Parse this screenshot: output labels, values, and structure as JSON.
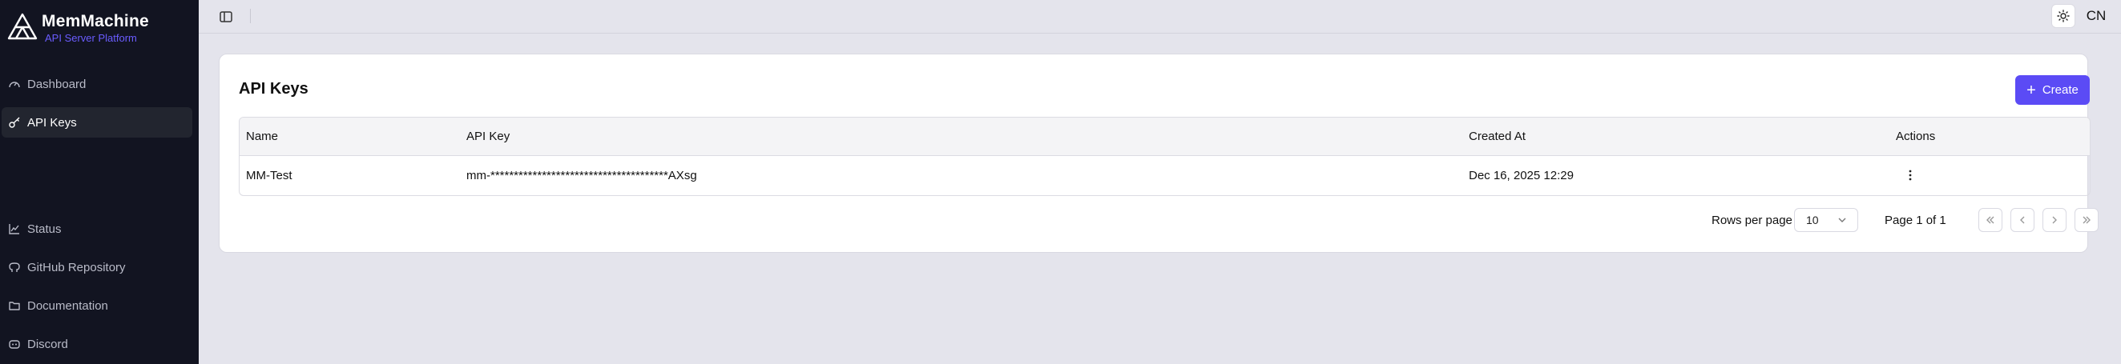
{
  "brand": {
    "title": "MemMachine",
    "subtitle": "API Server Platform"
  },
  "sidebar": {
    "items": [
      {
        "label": "Dashboard",
        "icon": "gauge-icon",
        "active": false
      },
      {
        "label": "API Keys",
        "icon": "key-icon",
        "active": true
      },
      {
        "label": "Status",
        "icon": "chart-line-icon",
        "active": false
      },
      {
        "label": "GitHub Repository",
        "icon": "github-icon",
        "active": false
      },
      {
        "label": "Documentation",
        "icon": "folder-icon",
        "active": false
      },
      {
        "label": "Discord",
        "icon": "discord-icon",
        "active": false
      }
    ]
  },
  "topbar": {
    "language_label": "CN"
  },
  "page": {
    "title": "API Keys",
    "create_label": "Create",
    "table": {
      "columns": [
        "Name",
        "API Key",
        "Created At",
        "Actions"
      ],
      "rows": [
        {
          "name": "MM-Test",
          "api_key": "mm-**************************************AXsg",
          "created_at": "Dec 16, 2025 12:29"
        }
      ]
    },
    "pagination": {
      "rows_per_page_label": "Rows per page",
      "rows_per_page_value": "10",
      "page_label": "Page 1 of 1"
    }
  },
  "colors": {
    "accent": "#5b4bf5",
    "sidebar_bg": "#121421",
    "page_bg": "#e4e4ec"
  }
}
